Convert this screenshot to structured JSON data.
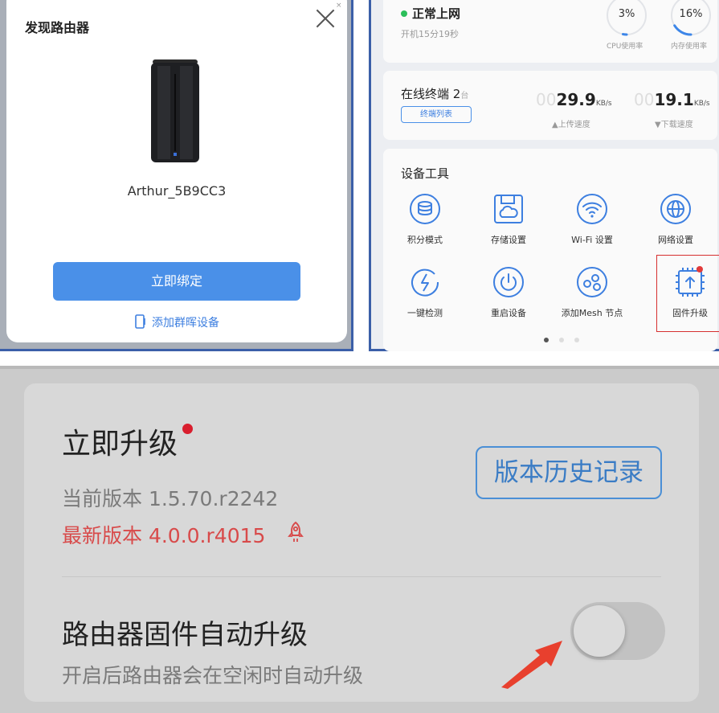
{
  "discover_dialog": {
    "title": "发现路由器",
    "close_hint": "×",
    "router_name": "Arthur_5B9CC3",
    "bind_button": "立即绑定",
    "add_nas_link": "添加群晖设备"
  },
  "status": {
    "network_status": "正常上网",
    "uptime": "开机15分19秒",
    "cpu_value": "3%",
    "cpu_label": "CPU使用率",
    "cpu_fraction": 0.03,
    "mem_value": "16%",
    "mem_label": "内存使用率",
    "mem_fraction": 0.16
  },
  "clients": {
    "title": "在线终端 2",
    "unit": "台",
    "list_button": "终端列表",
    "upload_ghost": "00",
    "upload_value": "29.9",
    "upload_unit": "KB/s",
    "upload_label": "▲上传速度",
    "download_ghost": "00",
    "download_value": "19.1",
    "download_unit": "KB/s",
    "download_label": "▼下载速度"
  },
  "tools": {
    "title": "设备工具",
    "items": [
      {
        "label": "积分模式",
        "icon": "coins-icon"
      },
      {
        "label": "存储设置",
        "icon": "storage-icon"
      },
      {
        "label": "Wi-Fi 设置",
        "icon": "wifi-icon"
      },
      {
        "label": "网络设置",
        "icon": "globe-icon"
      },
      {
        "label": "一键检测",
        "icon": "lightning-check-icon"
      },
      {
        "label": "重启设备",
        "icon": "power-icon"
      },
      {
        "label": "添加Mesh 节点",
        "icon": "mesh-icon"
      },
      {
        "label": "固件升级",
        "icon": "firmware-upgrade-icon"
      }
    ]
  },
  "upgrade": {
    "title": "立即升级",
    "current_version": "当前版本 1.5.70.r2242",
    "latest_version": "最新版本 4.0.0.r4015",
    "history_button": "版本历史记录",
    "auto_title": "路由器固件自动升级",
    "auto_desc": "开启后路由器会在空闲时自动升级",
    "auto_enabled": false
  },
  "colors": {
    "accent": "#4a90e8",
    "alert_red": "#d91e2e",
    "ok_green": "#2bbf5a",
    "arrow_red": "#e8402e"
  }
}
